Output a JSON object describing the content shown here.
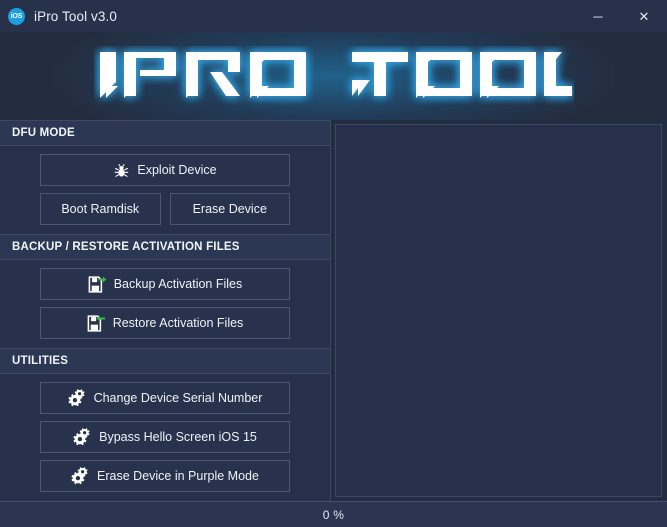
{
  "window": {
    "title": "iPro Tool v3.0",
    "app_icon": "ios-badge-icon",
    "minimize_label": "─",
    "close_label": "✕"
  },
  "banner": {
    "logo_text": "IPRO TOOL",
    "logo_color": "#ffffff",
    "glow_color": "#1e8cc8"
  },
  "sections": [
    {
      "id": "dfu-mode",
      "title": "DFU MODE",
      "buttons": [
        {
          "id": "exploit-device",
          "label": "Exploit Device",
          "icon": "bug-icon",
          "full_width": true
        },
        {
          "id": "boot-ramdisk",
          "label": "Boot Ramdisk",
          "icon": "none",
          "full_width": false
        },
        {
          "id": "erase-device",
          "label": "Erase Device",
          "icon": "none",
          "full_width": false
        }
      ]
    },
    {
      "id": "backup-restore",
      "title": "BACKUP / RESTORE ACTIVATION FILES",
      "buttons": [
        {
          "id": "backup-activation-files",
          "label": "Backup Activation Files",
          "icon": "floppy-arrow-right-icon",
          "full_width": true
        },
        {
          "id": "restore-activation-files",
          "label": "Restore Activation Files",
          "icon": "floppy-arrow-left-icon",
          "full_width": true
        }
      ]
    },
    {
      "id": "utilities",
      "title": "UTILITIES",
      "buttons": [
        {
          "id": "change-device-serial-number",
          "label": "Change Device Serial Number",
          "icon": "gears-icon",
          "full_width": true
        },
        {
          "id": "bypass-hello-screen-ios-15",
          "label": "Bypass Hello Screen iOS 15",
          "icon": "gears-icon",
          "full_width": true
        },
        {
          "id": "erase-device-in-purple-mode",
          "label": "Erase Device in Purple Mode",
          "icon": "gears-icon",
          "full_width": true
        }
      ]
    }
  ],
  "log": {
    "content": ""
  },
  "statusbar": {
    "progress_text": "0 %",
    "progress_percent": 0
  },
  "colors": {
    "accent": "#1a9fe0",
    "arrow_green": "#3cb44a",
    "panel_bg": "#26304a",
    "header_bg": "#2c3754",
    "border": "#4a5673"
  }
}
